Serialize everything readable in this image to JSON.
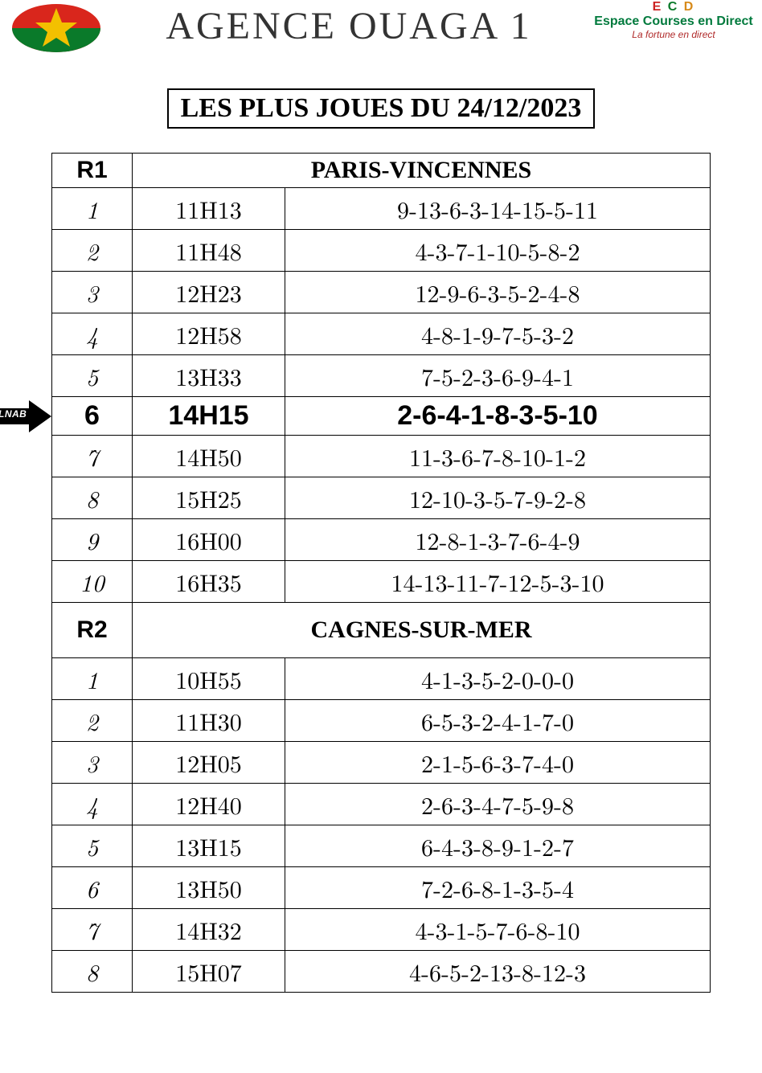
{
  "header": {
    "agency_title": "AGENCE  OUAGA 1",
    "brand_line1": "Espace Courses en Direct",
    "brand_line2": "La fortune en direct",
    "brand_letters": "E C D"
  },
  "subtitle": "LES PLUS JOUES DU 24/12/2023",
  "arrow_label": "LNAB",
  "reunions": [
    {
      "code": "R1",
      "venue": "PARIS-VINCENNES",
      "tall_header": false,
      "races": [
        {
          "num": "1",
          "time": "11H13",
          "picks": "9-13-6-3-14-15-5-11",
          "highlight": false
        },
        {
          "num": "2",
          "time": "11H48",
          "picks": "4-3-7-1-10-5-8-2",
          "highlight": false
        },
        {
          "num": "3",
          "time": "12H23",
          "picks": "12-9-6-3-5-2-4-8",
          "highlight": false
        },
        {
          "num": "4",
          "time": "12H58",
          "picks": "4-8-1-9-7-5-3-2",
          "highlight": false
        },
        {
          "num": "5",
          "time": "13H33",
          "picks": "7-5-2-3-6-9-4-1",
          "highlight": false
        },
        {
          "num": "6",
          "time": "14H15",
          "picks": "2-6-4-1-8-3-5-10",
          "highlight": true
        },
        {
          "num": "7",
          "time": "14H50",
          "picks": "11-3-6-7-8-10-1-2",
          "highlight": false
        },
        {
          "num": "8",
          "time": "15H25",
          "picks": "12-10-3-5-7-9-2-8",
          "highlight": false
        },
        {
          "num": "9",
          "time": "16H00",
          "picks": "12-8-1-3-7-6-4-9",
          "highlight": false
        },
        {
          "num": "10",
          "time": "16H35",
          "picks": "14-13-11-7-12-5-3-10",
          "highlight": false
        }
      ]
    },
    {
      "code": "R2",
      "venue": "CAGNES-SUR-MER",
      "tall_header": true,
      "races": [
        {
          "num": "1",
          "time": "10H55",
          "picks": "4-1-3-5-2-0-0-0",
          "highlight": false
        },
        {
          "num": "2",
          "time": "11H30",
          "picks": "6-5-3-2-4-1-7-0",
          "highlight": false
        },
        {
          "num": "3",
          "time": "12H05",
          "picks": "2-1-5-6-3-7-4-0",
          "highlight": false
        },
        {
          "num": "4",
          "time": "12H40",
          "picks": "2-6-3-4-7-5-9-8",
          "highlight": false
        },
        {
          "num": "5",
          "time": "13H15",
          "picks": "6-4-3-8-9-1-2-7",
          "highlight": false
        },
        {
          "num": "6",
          "time": "13H50",
          "picks": "7-2-6-8-1-3-5-4",
          "highlight": false
        },
        {
          "num": "7",
          "time": "14H32",
          "picks": "4-3-1-5-7-6-8-10",
          "highlight": false
        },
        {
          "num": "8",
          "time": "15H07",
          "picks": "4-6-5-2-13-8-12-3",
          "highlight": false
        }
      ]
    }
  ]
}
